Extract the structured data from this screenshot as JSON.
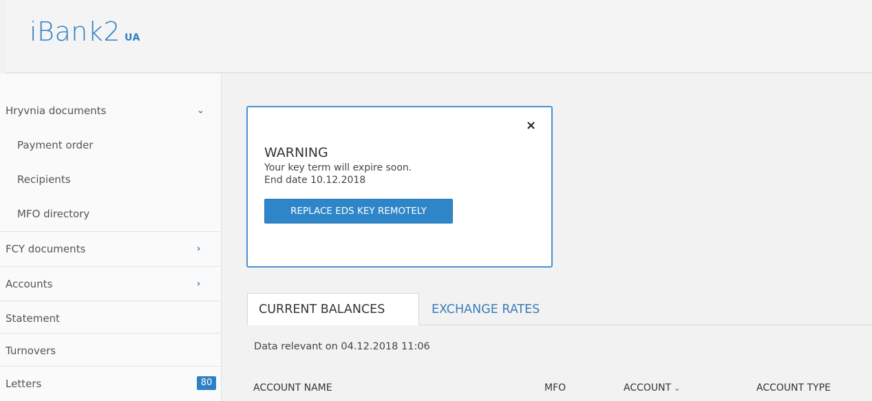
{
  "app": {
    "logo": "iBank2",
    "logo_suffix": "UA"
  },
  "sidebar": {
    "items": [
      {
        "label": "Hryvnia documents",
        "chevron": "⌄"
      },
      {
        "label": "Payment order"
      },
      {
        "label": "Recipients"
      },
      {
        "label": "MFO directory"
      },
      {
        "label": "FCY documents",
        "chevron": "›"
      },
      {
        "label": "Accounts",
        "chevron": "›"
      },
      {
        "label": "Statement"
      },
      {
        "label": "Turnovers"
      },
      {
        "label": "Letters",
        "badge": "80"
      }
    ]
  },
  "warning": {
    "close": "×",
    "title": "WARNING",
    "line1": "Your key term will expire soon.",
    "line2": "End date 10.12.2018",
    "button": "REPLACE EDS KEY REMOTELY"
  },
  "tabs": [
    {
      "label": "CURRENT BALANCES"
    },
    {
      "label": "EXCHANGE RATES"
    }
  ],
  "main": {
    "relevant": "Data relevant on 04.12.2018 11:06"
  },
  "table": {
    "headers": [
      "ACCOUNT NAME",
      "MFO",
      "ACCOUNT",
      "ACCOUNT TYPE"
    ],
    "sort_icon": "⌄"
  },
  "colors": {
    "accent": "#2e7fc4",
    "button": "#2e86c9",
    "modal_border": "#4a8fcf"
  }
}
